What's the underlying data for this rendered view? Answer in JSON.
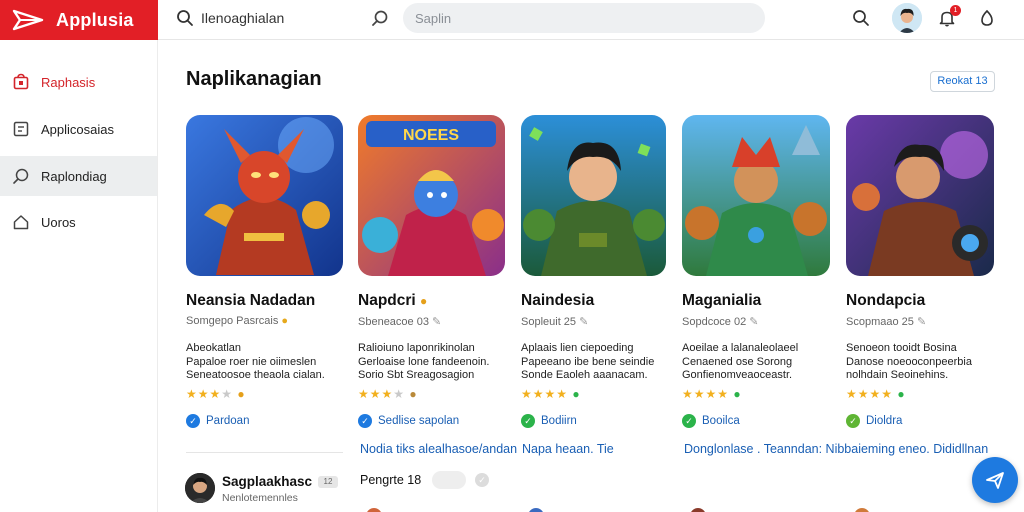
{
  "app": {
    "name": "Applusia",
    "brand_color": "#e21f26",
    "accent_color": "#1e7ae0"
  },
  "topbar": {
    "search_label": "Ilenoaghialan",
    "search_placeholder": "Saplin",
    "icons": [
      "search-icon",
      "tool-icon",
      "search-icon",
      "avatar",
      "notification-icon",
      "settings-icon"
    ],
    "notification_count": "1"
  },
  "sidebar": {
    "items": [
      {
        "label": "Raphasis",
        "icon": "store-icon",
        "state": "selected"
      },
      {
        "label": "Applicosaias",
        "icon": "apps-icon",
        "state": ""
      },
      {
        "label": "Raplondiag",
        "icon": "search-icon",
        "state": "hover"
      },
      {
        "label": "Uoros",
        "icon": "home-icon",
        "state": ""
      }
    ]
  },
  "main": {
    "section_title": "Naplikanagian",
    "see_all_label": "Reokat 13",
    "cards": [
      {
        "title": "Neansia Nadadan",
        "subtitle": "Somgepo Pasrcais",
        "desc_lines": [
          "Abeokatlan",
          "Papaloe roer nie oiimeslen",
          "Seneatoosoe theaola cialan."
        ],
        "rating": 3,
        "badge": "Pardoan",
        "badge_color": "#1e7ae0"
      },
      {
        "title": "Napdcri",
        "subtitle": "Sbeneacoe 03",
        "desc_lines": [
          "Ralioiuno laponrikinolan",
          "Gerloaise lone fandeenoin.",
          "Sorio Sbt Sreagosagion"
        ],
        "rating": 3,
        "badge": "Sedlise sapolan",
        "badge_color": "#1e7ae0"
      },
      {
        "title": "Naindesia",
        "subtitle": "Sopleuit 25",
        "desc_lines": [
          "Aplaais lien ciepoeding",
          "Papeeano ibe bene seindie",
          "Sonde Eaoleh aaanacam."
        ],
        "rating": 4,
        "badge": "Bodiirn",
        "badge_color": "#2bb34a"
      },
      {
        "title": "Maganialia",
        "subtitle": "Sopdcoce 02",
        "desc_lines": [
          "Aoeilae a lalanaleolaeel",
          "Cenaened ose Sorong",
          "Gonfienomveaoceastr."
        ],
        "rating": 4,
        "badge": "Booilca",
        "badge_color": "#2bb34a"
      },
      {
        "title": "Nondapcia",
        "subtitle": "Scopmaao 25",
        "desc_lines": [
          "Senoeon tooidt Bosina",
          "Danose noeooconpeerbia",
          "nolhdain Seoinehins."
        ],
        "rating": 4,
        "badge": "Dioldra",
        "badge_color": "#5fb534"
      }
    ],
    "links": [
      "Nodia tiks alealhasoe/andan",
      "Napa heaan. Tie",
      "Donglonlase . Teanndan: Nibbaieming eneo. Dididllnan"
    ],
    "user_row": {
      "name": "Sagplaakhasc",
      "sub": "Nenlotemennles",
      "tag": "12",
      "category_label": "Pengrte 18"
    }
  }
}
